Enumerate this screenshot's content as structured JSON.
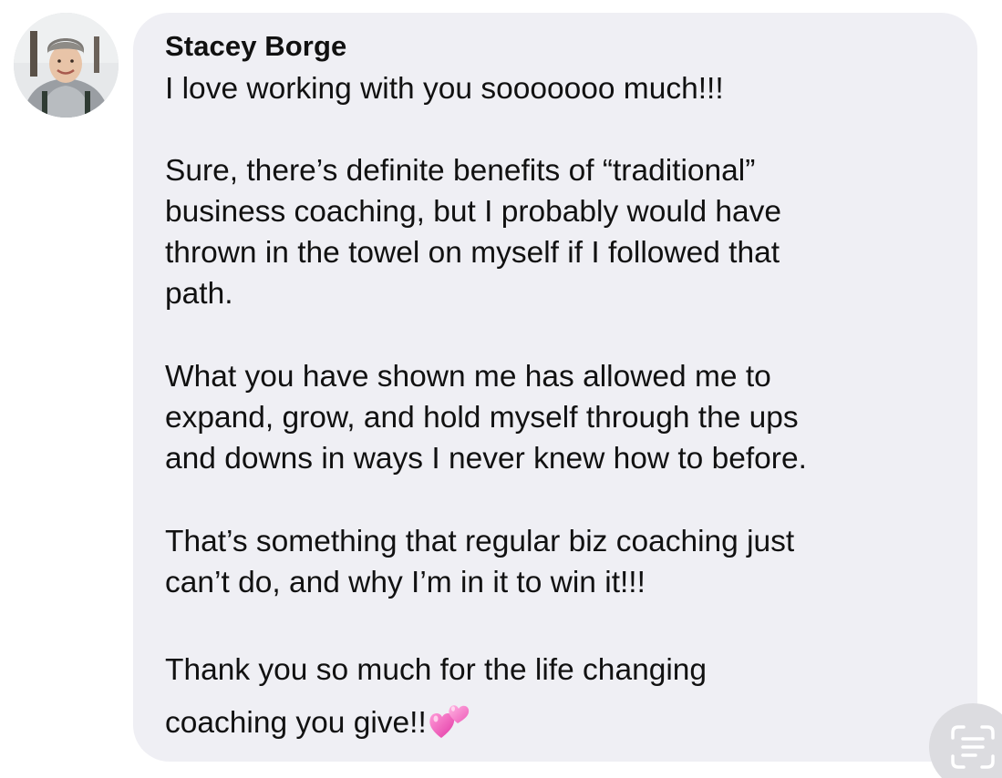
{
  "comment": {
    "author": "Stacey Borge",
    "avatar_icon": "profile-photo",
    "message_lines": [
      "I love working with you sooooooo much!!!",
      "Sure, there’s definite benefits of “traditional”",
      "business coaching, but I probably would have",
      "thrown in the towel on myself if I followed that",
      "path.",
      "What you have shown me has allowed me to",
      "expand, grow, and hold myself through the ups",
      "and downs in ways I never knew how to before.",
      "That’s something that regular biz coaching just",
      "can’t do, and why I’m in it to win it!!!",
      "Thank you so much for the life changing",
      "coaching you give!!"
    ],
    "trailing_emoji": "two-hearts-emoji"
  },
  "controls": {
    "live_text_icon": "live-text-scan-icon"
  },
  "colors": {
    "bubble_background": "#efeff4",
    "text": "#111111",
    "heart_pink": "#f472c4"
  }
}
